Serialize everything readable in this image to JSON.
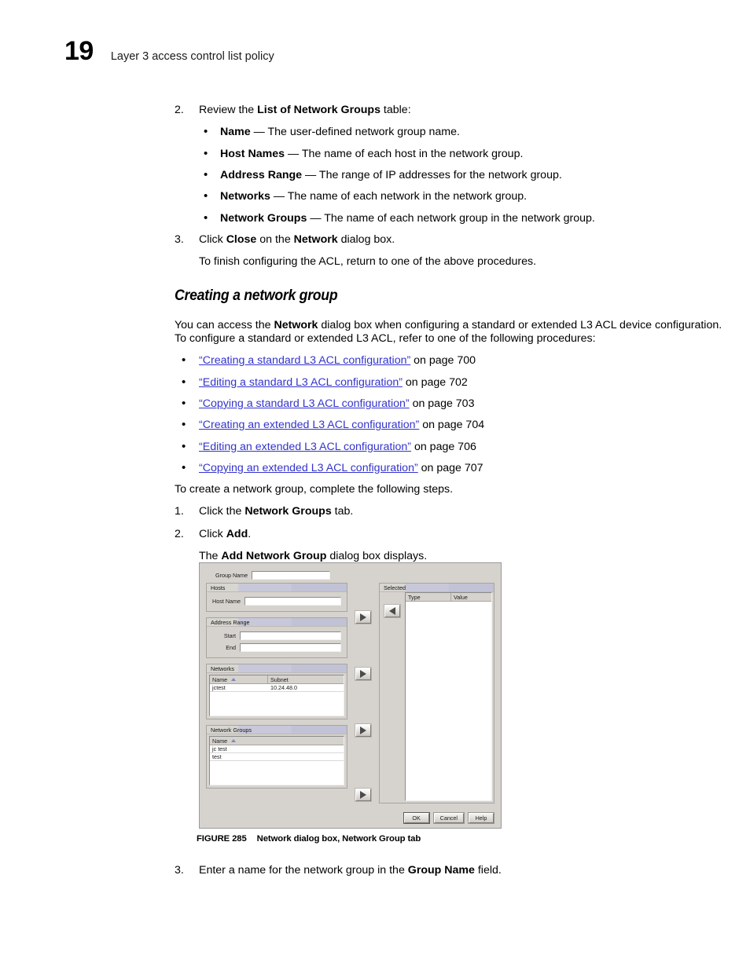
{
  "header": {
    "chapter_number": "19",
    "chapter_title": "Layer 3 access control list policy"
  },
  "body": {
    "step2": {
      "number": "2.",
      "text_before": "Review the ",
      "bold": "List of Network Groups",
      "text_after": " table:"
    },
    "definitions": [
      {
        "term": "Name",
        "dash": " — ",
        "desc": "The user-defined network group name."
      },
      {
        "term": "Host Names",
        "dash": " — ",
        "desc": "The name of each host in the network group."
      },
      {
        "term": "Address Range",
        "dash": " — ",
        "desc": "The range of IP addresses for the network group."
      },
      {
        "term": "Networks",
        "dash": " — ",
        "desc": "The name of each network in the network group."
      },
      {
        "term": "Network Groups",
        "dash": " — ",
        "desc": "The name of each network group in the network group."
      }
    ],
    "step3": {
      "number": "3.",
      "text_a": "Click ",
      "bold_a": "Close",
      "text_b": " on the ",
      "bold_b": "Network",
      "text_c": " dialog box."
    },
    "step3_note": "To finish configuring the ACL, return to one of the above procedures.",
    "section_heading": "Creating a network group",
    "intro_a": "You can access the ",
    "intro_bold": "Network",
    "intro_b": " dialog box when configuring a standard or extended L3 ACL device configuration. To configure a standard or extended L3 ACL, refer to one of the following procedures:",
    "links": [
      {
        "label": "“Creating a standard L3 ACL configuration”",
        "suffix": " on page 700"
      },
      {
        "label": "“Editing a standard L3 ACL configuration”",
        "suffix": " on page 702"
      },
      {
        "label": "“Copying a standard L3 ACL configuration”",
        "suffix": " on page 703"
      },
      {
        "label": "“Creating an extended L3 ACL configuration”",
        "suffix": " on page 704"
      },
      {
        "label": "“Editing an extended L3 ACL configuration”",
        "suffix": " on page 706"
      },
      {
        "label": "“Copying an extended L3 ACL configuration”",
        "suffix": " on page 707"
      }
    ],
    "create_intro": "To create a network group, complete the following steps.",
    "step_n1": {
      "number": "1.",
      "text_a": "Click the ",
      "bold": "Network Groups",
      "text_b": " tab."
    },
    "step_n2": {
      "number": "2.",
      "text_a": "Click ",
      "bold": "Add",
      "text_b": "."
    },
    "step_n2_note_a": "The ",
    "step_n2_note_bold": "Add Network Group",
    "step_n2_note_b": " dialog box displays.",
    "step_n3": {
      "number": "3.",
      "text_a": "Enter a name for the network group in the ",
      "bold": "Group Name",
      "text_b": " field."
    }
  },
  "figure": {
    "number": "FIGURE 285",
    "caption": "Network dialog box, Network Group tab"
  },
  "dialog": {
    "group_name": {
      "label": "Group Name",
      "value": ""
    },
    "hosts_panel": {
      "title": "Hosts",
      "host_name_label": "Host Name",
      "host_name_value": ""
    },
    "address_range_panel": {
      "title": "Address Range",
      "start_label": "Start",
      "start_value": "",
      "end_label": "End",
      "end_value": ""
    },
    "networks_panel": {
      "title": "Networks",
      "columns": [
        "Name",
        "Subnet"
      ],
      "rows": [
        {
          "name": "jctest",
          "subnet": "10.24.48.0"
        }
      ]
    },
    "network_groups_panel": {
      "title": "Network Groups",
      "columns": [
        "Name"
      ],
      "rows": [
        {
          "name": "jc test"
        },
        {
          "name": "test"
        }
      ]
    },
    "selected_panel": {
      "title": "Selected",
      "columns": [
        "Type",
        "Value"
      ],
      "rows": []
    },
    "buttons": {
      "ok": "OK",
      "cancel": "Cancel",
      "help": "Help"
    },
    "arrow_icons": {
      "add": "arrow-right-icon",
      "remove": "arrow-left-icon"
    }
  }
}
